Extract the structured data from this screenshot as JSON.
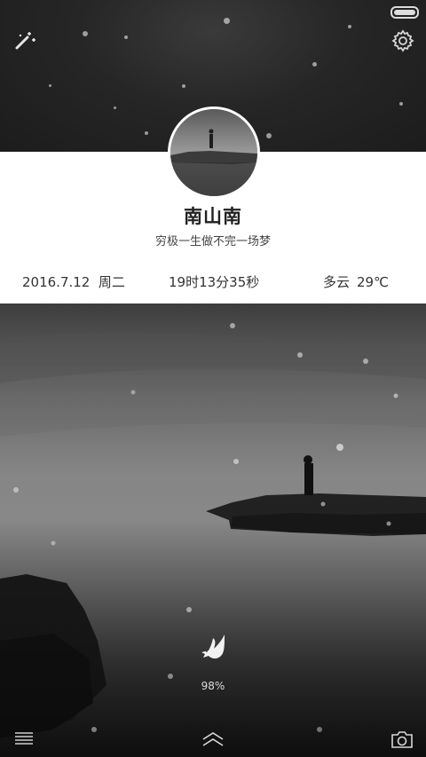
{
  "status_bar": {
    "battery_level": 1.0
  },
  "toolbar": {
    "left_icon": "magic-wand-icon",
    "right_icon": "gear-icon"
  },
  "profile": {
    "name": "南山南",
    "motto": "穷极一生做不完一场梦"
  },
  "info": {
    "date": "2016.7.12",
    "weekday": "周二",
    "time": "19时13分35秒",
    "weather": "多云",
    "temperature": "29℃"
  },
  "energy": {
    "icon": "bird-icon",
    "percent": "98%"
  },
  "bottom_bar": {
    "left_icon": "menu-icon",
    "center_icon": "chevron-up-icon",
    "right_icon": "camera-icon"
  },
  "colors": {
    "card_bg": "#ffffff",
    "top_bg": "#262626"
  }
}
